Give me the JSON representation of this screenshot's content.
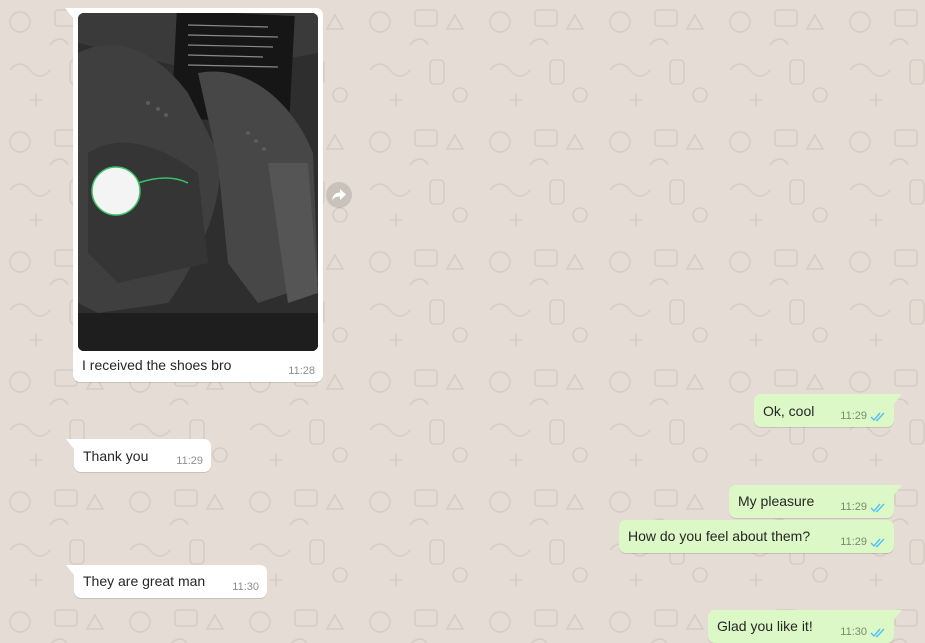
{
  "colors": {
    "chat_background": "#e5ddd5",
    "incoming_bubble": "#ffffff",
    "outgoing_bubble": "#dcf8c6",
    "read_ticks": "#4fc3f7"
  },
  "messages": [
    {
      "direction": "incoming",
      "type": "image",
      "image_subject": "black sneakers in a box",
      "caption": "I received the shoes bro",
      "time": "11:28"
    },
    {
      "direction": "outgoing",
      "text": "Ok, cool",
      "time": "11:29",
      "status": "read"
    },
    {
      "direction": "incoming",
      "text": "Thank you",
      "time": "11:29"
    },
    {
      "direction": "outgoing",
      "text": "My pleasure",
      "time": "11:29",
      "status": "read"
    },
    {
      "direction": "outgoing",
      "text": "How do you feel about them?",
      "time": "11:29",
      "status": "read"
    },
    {
      "direction": "incoming",
      "text": "They are great man",
      "time": "11:30"
    },
    {
      "direction": "outgoing",
      "text": "Glad you like it!",
      "time": "11:30",
      "status": "read"
    }
  ],
  "icons": {
    "forward": "forward-icon",
    "read_status": "double-check-icon"
  }
}
